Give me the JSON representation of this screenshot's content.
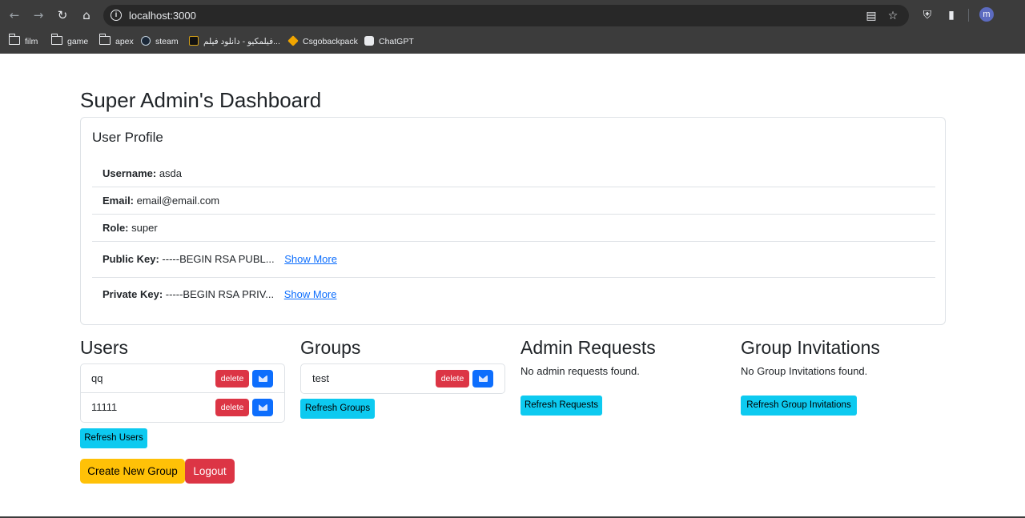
{
  "browser": {
    "url": "localhost:3000",
    "avatar_letter": "m",
    "bookmarks": [
      {
        "label": "film",
        "icon": "folder-icon"
      },
      {
        "label": "game",
        "icon": "folder-icon"
      },
      {
        "label": "apex",
        "icon": "folder-icon"
      },
      {
        "label": "steam",
        "icon": "steam-icon"
      },
      {
        "label": "فیلمکیو - دانلود فیلم...",
        "icon": "filmkio-icon"
      },
      {
        "label": "Csgobackpack",
        "icon": "csgobackpack-icon"
      },
      {
        "label": "ChatGPT",
        "icon": "chatgpt-icon"
      }
    ]
  },
  "page": {
    "title": "Super Admin's Dashboard",
    "profile": {
      "heading": "User Profile",
      "username_label": "Username:",
      "username": "asda",
      "email_label": "Email:",
      "email": "email@email.com",
      "role_label": "Role:",
      "role": "super",
      "public_key_label": "Public Key:",
      "public_key": "-----BEGIN RSA PUBL...",
      "private_key_label": "Private Key:",
      "private_key": "-----BEGIN RSA PRIV...",
      "show_more": "Show More"
    },
    "users": {
      "heading": "Users",
      "items": [
        {
          "name": "qq"
        },
        {
          "name": "11111"
        }
      ],
      "delete_label": "delete",
      "refresh_label": "Refresh Users"
    },
    "groups": {
      "heading": "Groups",
      "items": [
        {
          "name": "test"
        }
      ],
      "delete_label": "delete",
      "refresh_label": "Refresh Groups"
    },
    "admin_requests": {
      "heading": "Admin Requests",
      "empty": "No admin requests found.",
      "refresh_label": "Refresh Requests"
    },
    "group_invitations": {
      "heading": "Group Invitations",
      "empty": "No Group Invitations found.",
      "refresh_label": "Refresh Group Invitations"
    },
    "actions": {
      "create_group": "Create New Group",
      "logout": "Logout"
    }
  },
  "colors": {
    "primary": "#0d6efd",
    "danger": "#dc3545",
    "info": "#0dcaf0",
    "warning": "#ffc107"
  }
}
